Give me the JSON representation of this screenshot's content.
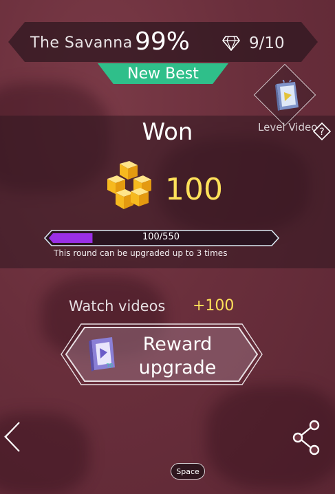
{
  "header": {
    "level_name": "The Savanna",
    "percent": "99%",
    "gem_icon": "diamond-gem-icon",
    "gem_count": "9/10"
  },
  "badge": {
    "new_best": "New Best"
  },
  "level_video": {
    "label": "Level Video",
    "icon": "level-video-tile-icon",
    "help_icon": "question-diamond-icon"
  },
  "result": {
    "title": "Won",
    "coins_icon": "gold-cubes-icon",
    "coin_value": "100"
  },
  "progress": {
    "text": "100/550",
    "current": 100,
    "max": 550,
    "note": "This round can be upgraded up to 3 times"
  },
  "watch": {
    "label": "Watch videos",
    "bonus": "+100"
  },
  "reward_button": {
    "line1": "Reward",
    "line2": "upgrade",
    "icon": "video-play-icon"
  },
  "navigation": {
    "back_icon": "chevron-left-icon",
    "share_icon": "share-icon"
  },
  "key_hint": {
    "label": "Space"
  },
  "colors": {
    "background": "#6e3340",
    "new_best": "#2fbf8a",
    "coin_text": "#ffe15a",
    "progress_fill": "#9a2fe6"
  }
}
